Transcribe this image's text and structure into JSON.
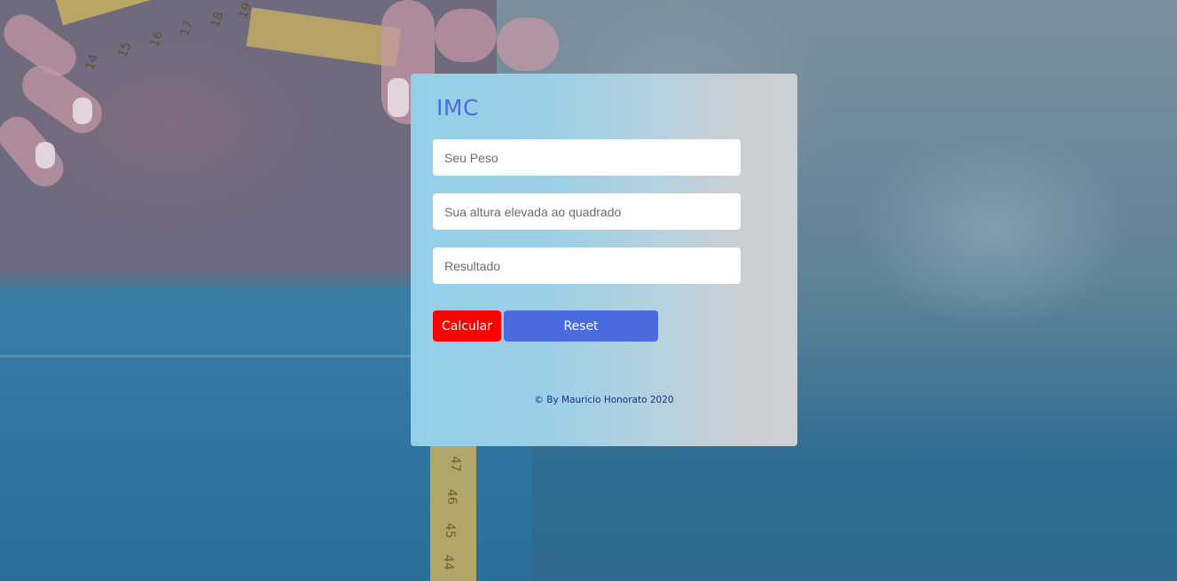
{
  "app": {
    "title": "IMC"
  },
  "form": {
    "weight": {
      "placeholder": "Seu Peso",
      "value": ""
    },
    "height": {
      "placeholder": "Sua altura elevada ao quadrado",
      "value": ""
    },
    "result": {
      "placeholder": "Resultado",
      "value": ""
    }
  },
  "buttons": {
    "calculate_label": "Calcular",
    "reset_label": "Reset"
  },
  "footer": {
    "text": "© By Mauricio Honorato 2020"
  },
  "background": {
    "tape_numbers": [
      "14",
      "15",
      "16",
      "17",
      "18",
      "19",
      "47",
      "46",
      "45",
      "44"
    ]
  },
  "colors": {
    "title": "#4a6ce0",
    "calculate_button": "#ff0000",
    "reset_button": "#4a6be0",
    "footer_text": "#1a2f8a"
  }
}
